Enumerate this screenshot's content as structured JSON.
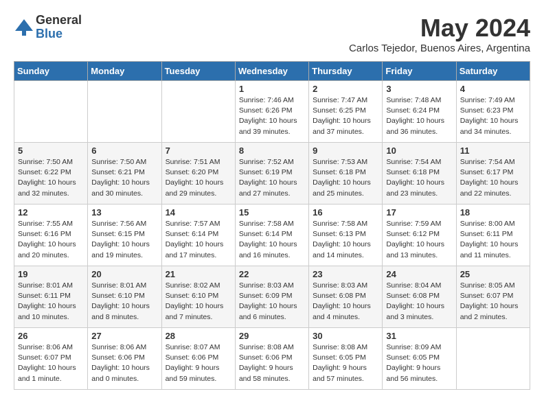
{
  "header": {
    "logo_general": "General",
    "logo_blue": "Blue",
    "title": "May 2024",
    "subtitle": "Carlos Tejedor, Buenos Aires, Argentina"
  },
  "days_of_week": [
    "Sunday",
    "Monday",
    "Tuesday",
    "Wednesday",
    "Thursday",
    "Friday",
    "Saturday"
  ],
  "weeks": [
    [
      {
        "day": "",
        "info": ""
      },
      {
        "day": "",
        "info": ""
      },
      {
        "day": "",
        "info": ""
      },
      {
        "day": "1",
        "info": "Sunrise: 7:46 AM\nSunset: 6:26 PM\nDaylight: 10 hours\nand 39 minutes."
      },
      {
        "day": "2",
        "info": "Sunrise: 7:47 AM\nSunset: 6:25 PM\nDaylight: 10 hours\nand 37 minutes."
      },
      {
        "day": "3",
        "info": "Sunrise: 7:48 AM\nSunset: 6:24 PM\nDaylight: 10 hours\nand 36 minutes."
      },
      {
        "day": "4",
        "info": "Sunrise: 7:49 AM\nSunset: 6:23 PM\nDaylight: 10 hours\nand 34 minutes."
      }
    ],
    [
      {
        "day": "5",
        "info": "Sunrise: 7:50 AM\nSunset: 6:22 PM\nDaylight: 10 hours\nand 32 minutes."
      },
      {
        "day": "6",
        "info": "Sunrise: 7:50 AM\nSunset: 6:21 PM\nDaylight: 10 hours\nand 30 minutes."
      },
      {
        "day": "7",
        "info": "Sunrise: 7:51 AM\nSunset: 6:20 PM\nDaylight: 10 hours\nand 29 minutes."
      },
      {
        "day": "8",
        "info": "Sunrise: 7:52 AM\nSunset: 6:19 PM\nDaylight: 10 hours\nand 27 minutes."
      },
      {
        "day": "9",
        "info": "Sunrise: 7:53 AM\nSunset: 6:18 PM\nDaylight: 10 hours\nand 25 minutes."
      },
      {
        "day": "10",
        "info": "Sunrise: 7:54 AM\nSunset: 6:18 PM\nDaylight: 10 hours\nand 23 minutes."
      },
      {
        "day": "11",
        "info": "Sunrise: 7:54 AM\nSunset: 6:17 PM\nDaylight: 10 hours\nand 22 minutes."
      }
    ],
    [
      {
        "day": "12",
        "info": "Sunrise: 7:55 AM\nSunset: 6:16 PM\nDaylight: 10 hours\nand 20 minutes."
      },
      {
        "day": "13",
        "info": "Sunrise: 7:56 AM\nSunset: 6:15 PM\nDaylight: 10 hours\nand 19 minutes."
      },
      {
        "day": "14",
        "info": "Sunrise: 7:57 AM\nSunset: 6:14 PM\nDaylight: 10 hours\nand 17 minutes."
      },
      {
        "day": "15",
        "info": "Sunrise: 7:58 AM\nSunset: 6:14 PM\nDaylight: 10 hours\nand 16 minutes."
      },
      {
        "day": "16",
        "info": "Sunrise: 7:58 AM\nSunset: 6:13 PM\nDaylight: 10 hours\nand 14 minutes."
      },
      {
        "day": "17",
        "info": "Sunrise: 7:59 AM\nSunset: 6:12 PM\nDaylight: 10 hours\nand 13 minutes."
      },
      {
        "day": "18",
        "info": "Sunrise: 8:00 AM\nSunset: 6:11 PM\nDaylight: 10 hours\nand 11 minutes."
      }
    ],
    [
      {
        "day": "19",
        "info": "Sunrise: 8:01 AM\nSunset: 6:11 PM\nDaylight: 10 hours\nand 10 minutes."
      },
      {
        "day": "20",
        "info": "Sunrise: 8:01 AM\nSunset: 6:10 PM\nDaylight: 10 hours\nand 8 minutes."
      },
      {
        "day": "21",
        "info": "Sunrise: 8:02 AM\nSunset: 6:10 PM\nDaylight: 10 hours\nand 7 minutes."
      },
      {
        "day": "22",
        "info": "Sunrise: 8:03 AM\nSunset: 6:09 PM\nDaylight: 10 hours\nand 6 minutes."
      },
      {
        "day": "23",
        "info": "Sunrise: 8:03 AM\nSunset: 6:08 PM\nDaylight: 10 hours\nand 4 minutes."
      },
      {
        "day": "24",
        "info": "Sunrise: 8:04 AM\nSunset: 6:08 PM\nDaylight: 10 hours\nand 3 minutes."
      },
      {
        "day": "25",
        "info": "Sunrise: 8:05 AM\nSunset: 6:07 PM\nDaylight: 10 hours\nand 2 minutes."
      }
    ],
    [
      {
        "day": "26",
        "info": "Sunrise: 8:06 AM\nSunset: 6:07 PM\nDaylight: 10 hours\nand 1 minute."
      },
      {
        "day": "27",
        "info": "Sunrise: 8:06 AM\nSunset: 6:06 PM\nDaylight: 10 hours\nand 0 minutes."
      },
      {
        "day": "28",
        "info": "Sunrise: 8:07 AM\nSunset: 6:06 PM\nDaylight: 9 hours\nand 59 minutes."
      },
      {
        "day": "29",
        "info": "Sunrise: 8:08 AM\nSunset: 6:06 PM\nDaylight: 9 hours\nand 58 minutes."
      },
      {
        "day": "30",
        "info": "Sunrise: 8:08 AM\nSunset: 6:05 PM\nDaylight: 9 hours\nand 57 minutes."
      },
      {
        "day": "31",
        "info": "Sunrise: 8:09 AM\nSunset: 6:05 PM\nDaylight: 9 hours\nand 56 minutes."
      },
      {
        "day": "",
        "info": ""
      }
    ]
  ]
}
